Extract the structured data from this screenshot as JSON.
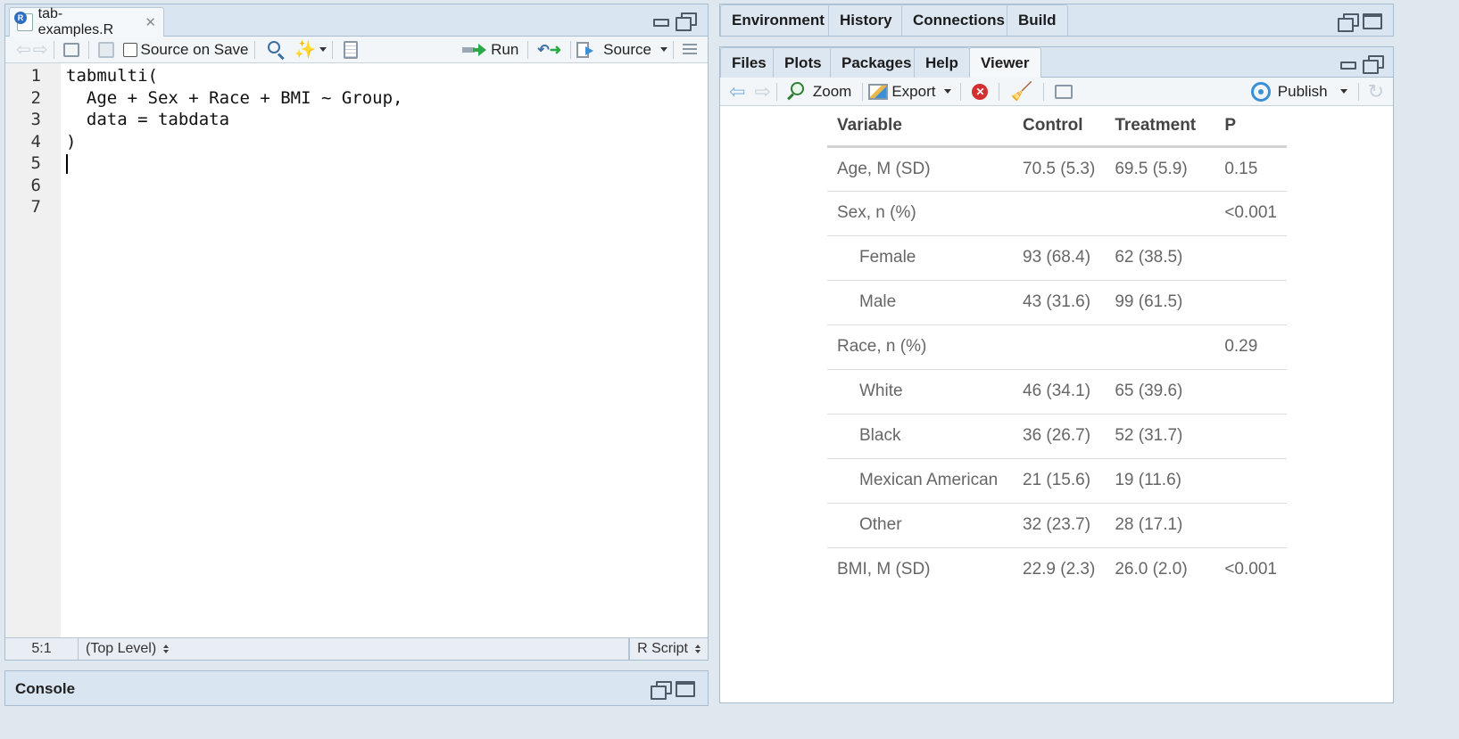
{
  "editor": {
    "file_tab": "tab-examples.R",
    "toolbar": {
      "source_on_save": "Source on Save",
      "run": "Run",
      "source": "Source"
    },
    "lines": [
      {
        "n": "1",
        "text": "tabmulti("
      },
      {
        "n": "2",
        "text": "  Age + Sex + Race + BMI ~ Group,"
      },
      {
        "n": "3",
        "text": "  data = tabdata"
      },
      {
        "n": "4",
        "text": ")"
      },
      {
        "n": "5",
        "text": ""
      },
      {
        "n": "6",
        "text": ""
      },
      {
        "n": "7",
        "text": ""
      }
    ],
    "status": {
      "position": "5:1",
      "scope": "(Top Level)",
      "filetype": "R Script"
    }
  },
  "console": {
    "title": "Console"
  },
  "top_right": {
    "tabs": [
      "Environment",
      "History",
      "Connections",
      "Build"
    ]
  },
  "bottom_right": {
    "tabs": [
      "Files",
      "Plots",
      "Packages",
      "Help",
      "Viewer"
    ],
    "active_tab": "Viewer",
    "toolbar": {
      "zoom": "Zoom",
      "export": "Export",
      "publish": "Publish"
    }
  },
  "viewer_table": {
    "headers": [
      "Variable",
      "Control",
      "Treatment",
      "P"
    ],
    "rows": [
      {
        "variable": "Age, M (SD)",
        "control": "70.5 (5.3)",
        "treatment": "69.5 (5.9)",
        "p": "0.15",
        "indent": false
      },
      {
        "variable": "Sex, n (%)",
        "control": "",
        "treatment": "",
        "p": "<0.001",
        "indent": false
      },
      {
        "variable": "Female",
        "control": "93 (68.4)",
        "treatment": "62 (38.5)",
        "p": "",
        "indent": true
      },
      {
        "variable": "Male",
        "control": "43 (31.6)",
        "treatment": "99 (61.5)",
        "p": "",
        "indent": true
      },
      {
        "variable": "Race, n (%)",
        "control": "",
        "treatment": "",
        "p": "0.29",
        "indent": false
      },
      {
        "variable": "White",
        "control": "46 (34.1)",
        "treatment": "65 (39.6)",
        "p": "",
        "indent": true
      },
      {
        "variable": "Black",
        "control": "36 (26.7)",
        "treatment": "52 (31.7)",
        "p": "",
        "indent": true
      },
      {
        "variable": "Mexican American",
        "control": "21 (15.6)",
        "treatment": "19 (11.6)",
        "p": "",
        "indent": true
      },
      {
        "variable": "Other",
        "control": "32 (23.7)",
        "treatment": "28 (17.1)",
        "p": "",
        "indent": true
      },
      {
        "variable": "BMI, M (SD)",
        "control": "22.9 (2.3)",
        "treatment": "26.0 (2.0)",
        "p": "<0.001",
        "indent": false
      }
    ]
  },
  "colors": {
    "pane_header": "#d9e5f0",
    "accent_green": "#2aa84a",
    "accent_blue": "#3a8fd6",
    "stop_red": "#d32f2f"
  }
}
